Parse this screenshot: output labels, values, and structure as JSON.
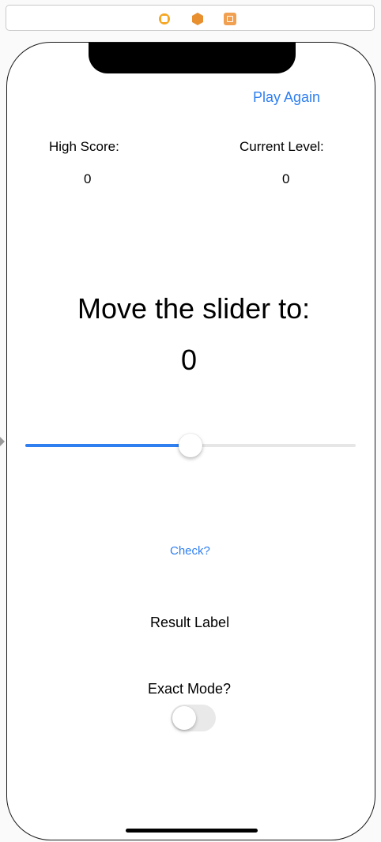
{
  "scene_dock": {
    "icons": [
      "view-controller-icon",
      "first-responder-icon",
      "exit-icon"
    ],
    "colors": {
      "vc": "#f5a623",
      "cube": "#e8902f",
      "exit": "#f0a050"
    }
  },
  "header": {
    "play_again_label": "Play Again"
  },
  "stats": {
    "high_score_label": "High Score:",
    "high_score_value": "0",
    "current_level_label": "Current Level:",
    "current_level_value": "0"
  },
  "target": {
    "prompt": "Move the slider to:",
    "value": "0"
  },
  "slider": {
    "value": 0.5,
    "min": 0,
    "max": 1,
    "tint_color": "#2f7ff0"
  },
  "check_label": "Check?",
  "result_label": "Result Label",
  "exact_mode": {
    "label": "Exact Mode?",
    "on": false
  }
}
